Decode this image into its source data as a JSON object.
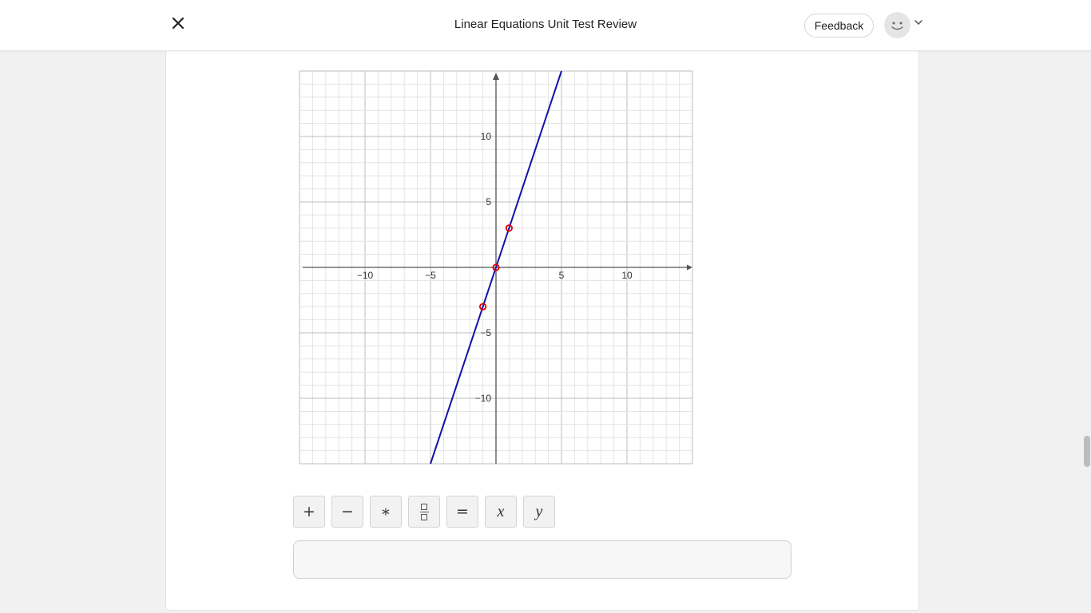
{
  "header": {
    "title": "Linear Equations Unit Test Review",
    "feedback_label": "Feedback",
    "close_icon": "close-icon",
    "avatar_icon": "smiley-avatar-icon",
    "menu_icon": "chevron-down-icon"
  },
  "colors": {
    "line": "#1111aa",
    "points": "#e00000",
    "grid_minor": "#e3e3e3",
    "grid_major": "#bdbdbd",
    "axis": "#555555"
  },
  "chart_data": {
    "type": "line",
    "title": "",
    "xlabel": "",
    "ylabel": "",
    "xlim": [
      -15,
      15
    ],
    "ylim": [
      -15,
      15
    ],
    "grid": true,
    "x_ticks": [
      -10,
      -5,
      5,
      10
    ],
    "y_ticks": [
      -10,
      -5,
      5,
      10
    ],
    "x_tick_labels": [
      "−10",
      "−5",
      "5",
      "10"
    ],
    "y_tick_labels": [
      "−10",
      "−5",
      "5",
      "10"
    ],
    "series": [
      {
        "x": [
          -5,
          5
        ],
        "y": [
          -15,
          15
        ]
      }
    ],
    "points": [
      {
        "x": -1,
        "y": -3
      },
      {
        "x": 0,
        "y": 0
      },
      {
        "x": 1,
        "y": 3
      }
    ]
  },
  "toolbar": {
    "buttons": [
      {
        "label": "+",
        "icon": "plus-icon"
      },
      {
        "label": "−",
        "icon": "minus-icon"
      },
      {
        "label": "∗",
        "icon": "multiply-icon"
      },
      {
        "label": "",
        "icon": "fraction-icon"
      },
      {
        "label": "=",
        "icon": "equals-icon"
      },
      {
        "label": "x",
        "icon": "variable-x"
      },
      {
        "label": "y",
        "icon": "variable-y"
      }
    ]
  },
  "answer": {
    "value": "",
    "placeholder": ""
  }
}
